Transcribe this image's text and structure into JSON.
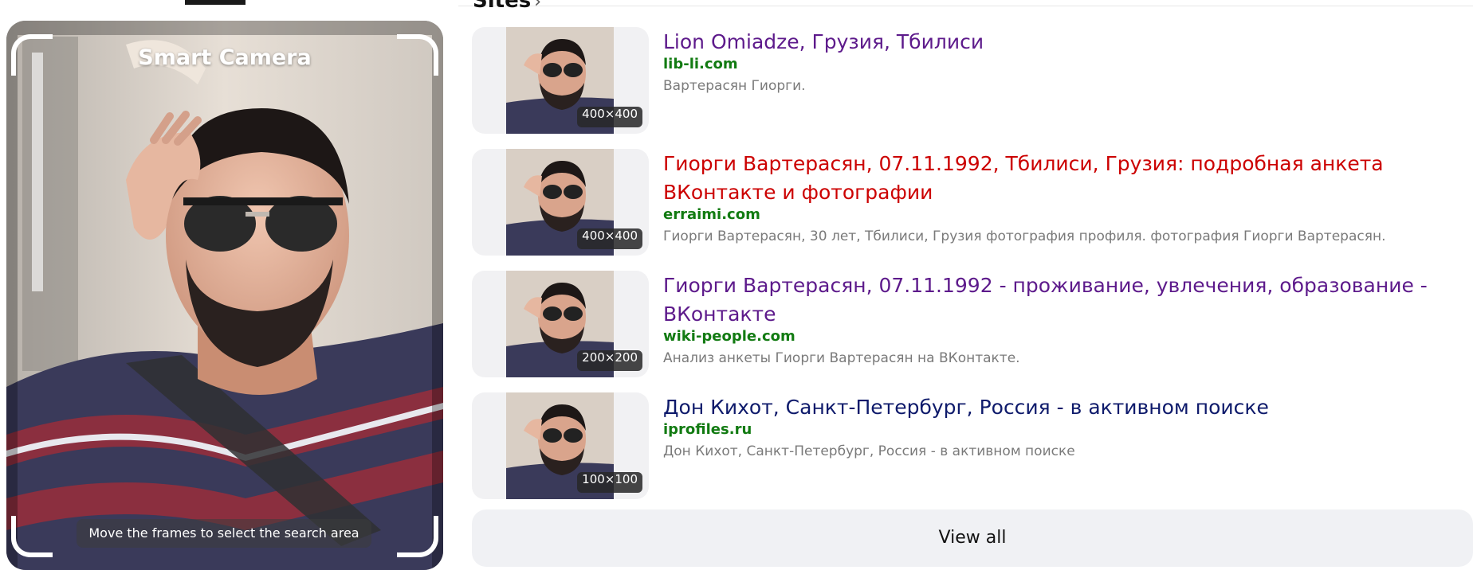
{
  "header": {
    "section_title": "Sites"
  },
  "camera": {
    "title": "Smart Camera",
    "hint": "Move the frames to select the search area"
  },
  "results": [
    {
      "title": "Lion Omiadze, Грузия, Тбилиси",
      "title_color": "#5d1a8b",
      "domain": "lib-li.com",
      "snippet": "Вартерасян Гиорги.",
      "size": "400×400"
    },
    {
      "title": "Гиорги Вартерасян, 07.11.1992, Тбилиси, Грузия: подробная анкета ВКонтакте и фотографии",
      "title_color": "#cc0000",
      "domain": "erraimi.com",
      "snippet": "Гиорги Вартерасян, 30 лет, Тбилиси, Грузия фотография профиля. фотография Гиорги Вартерасян.",
      "size": "400×400"
    },
    {
      "title": "Гиорги Вартерасян, 07.11.1992 - проживание, увлечения, образование - ВКонтакте",
      "title_color": "#5d1a8b",
      "domain": "wiki-people.com",
      "snippet": "Анализ анкеты Гиорги Вартерасян на ВКонтакте.",
      "size": "200×200"
    },
    {
      "title": "Дон Кихот, Санкт-Петербург, Россия - в активном поиске",
      "title_color": "#0e1a6b",
      "domain": "iprofiles.ru",
      "snippet": "Дон Кихот, Санкт-Петербург, Россия - в активном поиске",
      "size": "100×100"
    }
  ],
  "view_all_label": "View all",
  "icons": {
    "sites_chevron": "chevron-right-icon"
  }
}
